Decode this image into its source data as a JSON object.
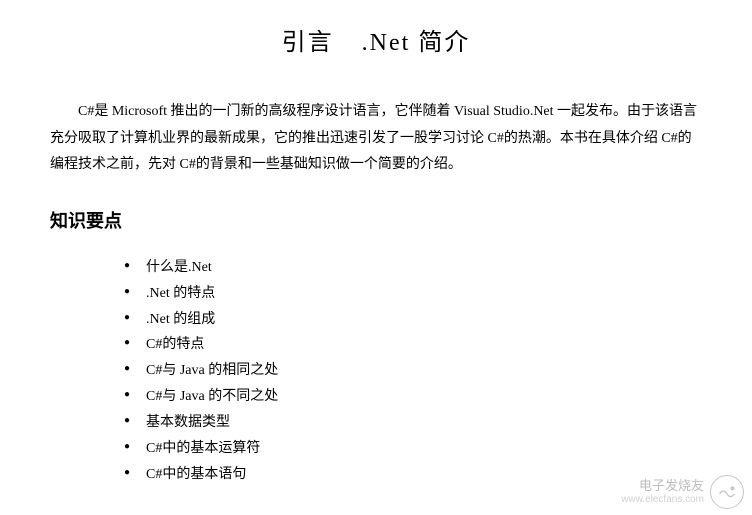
{
  "title_part1": "引言",
  "title_part2": ".Net 简介",
  "intro_paragraph": "C#是 Microsoft 推出的一门新的高级程序设计语言，它伴随着 Visual Studio.Net 一起发布。由于该语言充分吸取了计算机业界的最新成果，它的推出迅速引发了一股学习讨论 C#的热潮。本书在具体介绍 C#的编程技术之前，先对 C#的背景和一些基础知识做一个简要的介绍。",
  "section_heading": "知识要点",
  "bullets": [
    "什么是.Net",
    ".Net 的特点",
    ".Net 的组成",
    "C#的特点",
    "C#与 Java 的相同之处",
    "C#与 Java 的不同之处",
    "基本数据类型",
    "C#中的基本运算符",
    "C#中的基本语句"
  ],
  "watermark": {
    "brand": "电子发烧友",
    "url": "www.elecfans.com"
  }
}
